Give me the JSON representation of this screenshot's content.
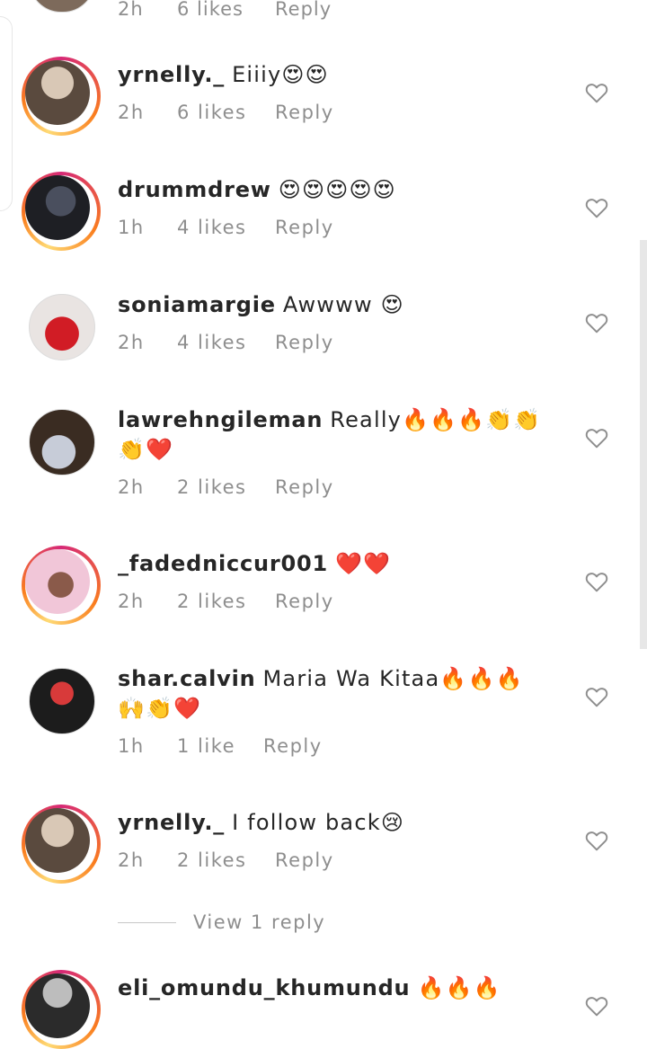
{
  "partial_top": {
    "time": "2h",
    "likes": "6 likes",
    "reply": "Reply"
  },
  "comments": [
    {
      "user": "yrnelly._",
      "text": "Eiiiy😍😍",
      "time": "2h",
      "likes": "6 likes",
      "reply": "Reply",
      "story_ring": true,
      "avatar_colors": [
        "#5a4a3e",
        "#d9c8b6"
      ]
    },
    {
      "user": "drummdrew",
      "text": "😍😍😍😍😍",
      "time": "1h",
      "likes": "4 likes",
      "reply": "Reply",
      "story_ring": true,
      "avatar_colors": [
        "#1e1f24",
        "#4a4f5e"
      ]
    },
    {
      "user": "soniamargie",
      "text": "Awwww 😍",
      "time": "2h",
      "likes": "4 likes",
      "reply": "Reply",
      "story_ring": false,
      "avatar_colors": [
        "#d11c25",
        "#e9e4e2"
      ]
    },
    {
      "user": "lawrehngileman",
      "text": "Really🔥🔥🔥👏👏👏❤️",
      "time": "2h",
      "likes": "2 likes",
      "reply": "Reply",
      "story_ring": false,
      "avatar_colors": [
        "#3a2c22",
        "#c7ccd8"
      ]
    },
    {
      "user": "_fadedniccur001",
      "text": "❤️❤️",
      "time": "2h",
      "likes": "2 likes",
      "reply": "Reply",
      "story_ring": true,
      "avatar_colors": [
        "#f1c6d8",
        "#8a5a4a"
      ]
    },
    {
      "user": "shar.calvin",
      "text": "Maria Wa Kitaa🔥🔥🔥🙌👏❤️",
      "time": "1h",
      "likes": "1 like",
      "reply": "Reply",
      "story_ring": false,
      "avatar_colors": [
        "#1c1c1c",
        "#d83a3a"
      ]
    },
    {
      "user": "yrnelly._",
      "text": "I follow back😢",
      "time": "2h",
      "likes": "2 likes",
      "reply": "Reply",
      "story_ring": true,
      "avatar_colors": [
        "#5a4a3e",
        "#d9c8b6"
      ]
    },
    {
      "user": "eli_omundu_khumundu",
      "text": "🔥🔥🔥",
      "time": "",
      "likes": "",
      "reply": "",
      "story_ring": true,
      "avatar_colors": [
        "#2b2b2b",
        "#bdbdbd"
      ]
    }
  ],
  "view_replies": "View 1 reply",
  "colors": {
    "text": "#262626",
    "meta": "#8e8e8e",
    "ring_start": "#d62976",
    "ring_end": "#fa7e1e"
  },
  "icons": {
    "like": "heart-outline-icon"
  }
}
